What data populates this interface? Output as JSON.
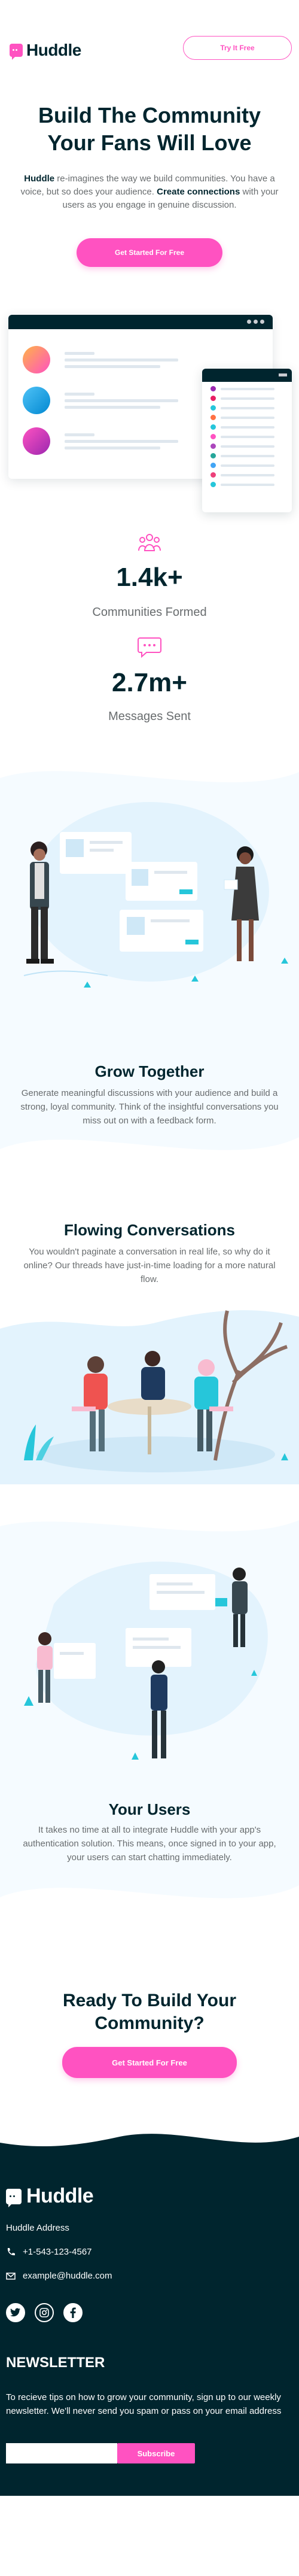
{
  "header": {
    "brand": "Huddle",
    "try_button": "Try It Free"
  },
  "hero": {
    "title": "Build The Community Your Fans Will Love",
    "desc_brand": "Huddle",
    "desc_part1": " re-imagines the way we build communities. You have a voice, but so does your audience. ",
    "desc_bold": "Create connections",
    "desc_part2": " with your users as you engage in genuine discussion.",
    "cta": "Get Started For Free"
  },
  "stats": [
    {
      "icon": "communities-icon",
      "value": "1.4k+",
      "label": "Communities Formed"
    },
    {
      "icon": "messages-icon",
      "value": "2.7m+",
      "label": "Messages Sent"
    }
  ],
  "features": [
    {
      "title": "Grow Together",
      "text": "Generate meaningful discussions with your audience and build a strong, loyal community. Think of the insightful conversations you miss out on with a feedback form."
    },
    {
      "title": "Flowing Conversations",
      "text": "You wouldn't paginate a conversation in real life, so why do it online? Our threads have just-in-time loading for a more natural flow."
    },
    {
      "title": "Your Users",
      "text": "It takes no time at all to integrate Huddle with your app's authentication solution. This means, once signed in to your app, your users can start chatting immediately."
    }
  ],
  "cta": {
    "title": "Ready To Build Your Community?",
    "button": "Get Started For Free"
  },
  "footer": {
    "brand": "Huddle",
    "address": "Huddle Address",
    "phone": "+1-543-123-4567",
    "email": "example@huddle.com",
    "social_icons": [
      "twitter-icon",
      "instagram-icon",
      "facebook-icon"
    ],
    "newsletter_title": "NEWSLETTER",
    "newsletter_text": "To recieve tips on how to grow your community, sign up to our weekly newsletter. We'll never send you spam or pass on your email address",
    "email_placeholder": "",
    "subscribe": "Subscribe"
  },
  "colors": {
    "pink": "#ff52c1",
    "dark_cyan": "#00252e",
    "light_bg": "#f5fbff",
    "gray_text": "#686c6e"
  }
}
